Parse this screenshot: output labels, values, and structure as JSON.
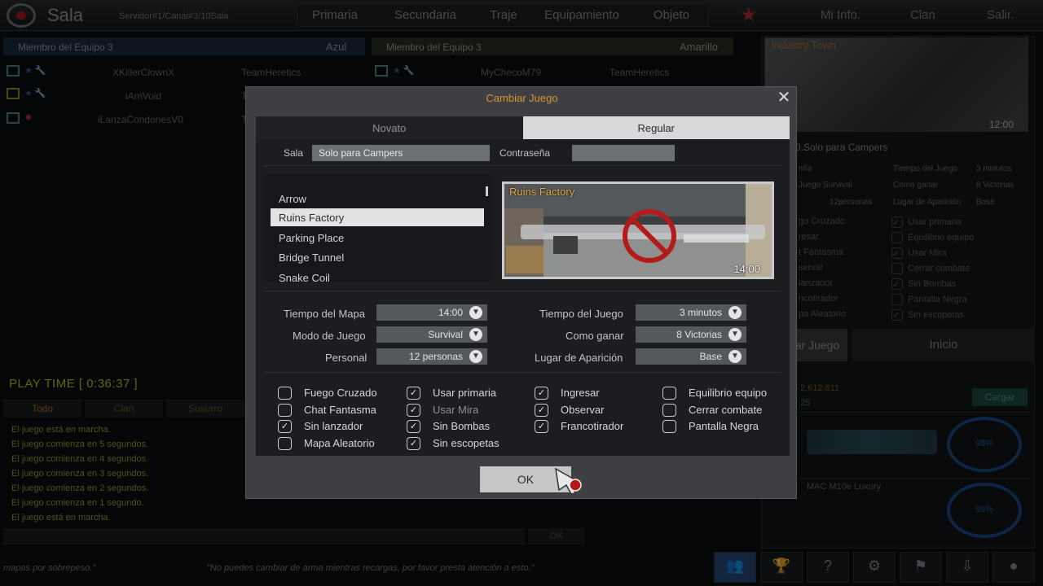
{
  "background": {
    "room_title": "Sala",
    "server_line": "Servidor#1/Canal#3/10Sala",
    "weapon_tabs": [
      "Primaria",
      "Secundaria",
      "Traje",
      "Equipamiento",
      "Objeto"
    ],
    "top_menu": [
      "Mi Info.",
      "Clan",
      "Salir."
    ],
    "team_blue_header": "Miembro del Equipo 3",
    "team_blue_label": "Azul",
    "team_yellow_header": "Miembro del Equipo 3",
    "team_yellow_label": "Amarillo",
    "blue_players": [
      {
        "name": "XKillerClownX",
        "clan": "TeamHeretics"
      },
      {
        "name": "iAmVoid",
        "clan": "T"
      },
      {
        "name": "iLanzaCondonesV0",
        "clan": "T"
      }
    ],
    "yellow_players": [
      {
        "name": "MyChecoM79",
        "clan": "TeamHeretics"
      }
    ],
    "play_time": "PLAY TIME [ 0:36:37 ]",
    "chat_tabs": [
      "Todo",
      "Clan",
      "Susurro"
    ],
    "chat_lines": [
      "El juego está en marcha.",
      "El juego comienza en 5 segundos.",
      "El juego comienza en 4 segundos.",
      "El juego comienza en 3 segundos.",
      "El juego comienza en 2 segundos.",
      "El juego comienza en 1 segundo.",
      "El juego está en marcha."
    ],
    "chat_ok": "OK",
    "ticker_left": "mapas por sobrepeso.\"",
    "ticker_right": "\"No puedes cambiar de arma mientras recargas, por favor presta atención a esto.\"",
    "side_map_name": "Industry Town",
    "side_map_time": "12:00",
    "side_room_name": "0.Solo para Campers",
    "side_details": [
      {
        "label": "eña",
        "key": "Tiempo del Juego",
        "value": "3 minutos"
      },
      {
        "label": "Juego Survival",
        "key": "Como ganar",
        "value": "8 Victorias"
      },
      {
        "label": "12personas",
        "key": "Lugar de Aparición",
        "value": "Base"
      }
    ],
    "side_checks_left": [
      "go Cruzado",
      "resar",
      "t Fantasma",
      "servar",
      "lanzador",
      "ncotirador",
      "pa Aleatorio"
    ],
    "side_checks_right": [
      "Usar primaria",
      "Equilibrio equipo",
      "Usar Mira",
      "Cerrar combate",
      "Sin Bombas",
      "Pantalla Negra",
      "Sin escopetas"
    ],
    "side_btn_change": "ar Juego",
    "side_btn_start": "Inicio",
    "side_money_1": "2,612,811",
    "side_money_2": "25",
    "side_cargar": "Cargar",
    "slot_1_pct": "98%",
    "slot_2_name": "MAC M10e Luxury",
    "slot_2_pct": "99%",
    "bottom_icons": [
      "team-icon",
      "trophy-icon",
      "help-icon",
      "gear-icon",
      "flag-icon",
      "inbox-icon",
      "user-icon"
    ]
  },
  "modal": {
    "title": "Cambiar Juego",
    "close_glyph": "✕",
    "tabs": [
      {
        "label": "Novato",
        "active": false
      },
      {
        "label": "Regular",
        "active": true
      }
    ],
    "room_label": "Sala",
    "room_value": "Solo para Campers",
    "password_label": "Contraseña",
    "password_value": "",
    "maps": [
      "Arrow",
      "Ruins Factory",
      "Parking Place",
      "Bridge Tunnel",
      "Snake Coil"
    ],
    "selected_map_index": 1,
    "preview_name": "Ruins Factory",
    "preview_time": "14:00",
    "settings": [
      {
        "label": "Tiempo del Mapa",
        "value": "14:00"
      },
      {
        "label": "Modo de Juego",
        "value": "Survival"
      },
      {
        "label": "Personal",
        "value": "12 personas"
      },
      {
        "label": "Tiempo del Juego",
        "value": "3 minutos"
      },
      {
        "label": "Como ganar",
        "value": "8 Victorias"
      },
      {
        "label": "Lugar de Aparición",
        "value": "Base"
      }
    ],
    "options": [
      {
        "label": "Fuego Cruzado",
        "checked": false
      },
      {
        "label": "Chat Fantasma",
        "checked": false
      },
      {
        "label": "Sin lanzador",
        "checked": true
      },
      {
        "label": "Mapa Aleatorio",
        "checked": false
      },
      {
        "label": "Usar primaria",
        "checked": true
      },
      {
        "label": "Usar Mira",
        "checked": true
      },
      {
        "label": "Sin Bombas",
        "checked": true
      },
      {
        "label": "Sin escopetas",
        "checked": true
      },
      {
        "label": "Ingresar",
        "checked": true
      },
      {
        "label": "Observar",
        "checked": true
      },
      {
        "label": "Francotirador",
        "checked": true
      },
      {
        "label": "Equilibrio equipo",
        "checked": false
      },
      {
        "label": "Cerrar combate",
        "checked": false
      },
      {
        "label": "Pantalla Negra",
        "checked": false
      }
    ],
    "ok_label": "OK"
  },
  "colors": {
    "accent_orange": "#d8952c",
    "playtime_yellow": "#c6c61f",
    "chat_green": "#9ca61a"
  }
}
